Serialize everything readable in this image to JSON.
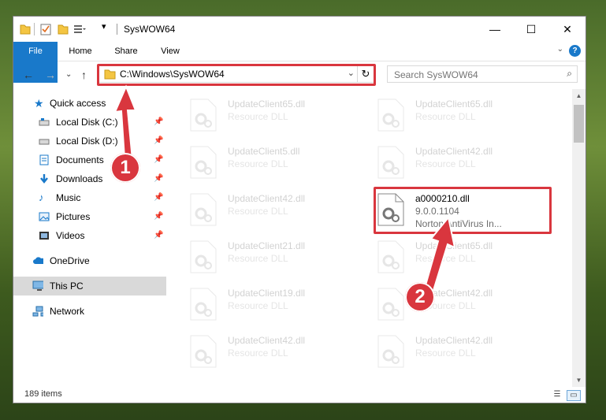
{
  "window": {
    "title": "SysWOW64",
    "minimize": "—",
    "maximize": "☐",
    "close": "✕"
  },
  "ribbon": {
    "tabs": [
      {
        "label": "File"
      },
      {
        "label": "Home"
      },
      {
        "label": "Share"
      },
      {
        "label": "View"
      }
    ],
    "help": "?"
  },
  "address": {
    "path": "C:\\Windows\\SysWOW64",
    "refresh": "↻"
  },
  "search": {
    "placeholder": "Search SysWOW64"
  },
  "nav": {
    "items": [
      {
        "label": "Quick access",
        "pinned": false
      },
      {
        "label": "Local Disk (C:)",
        "pinned": true
      },
      {
        "label": "Local Disk (D:)",
        "pinned": true
      },
      {
        "label": "Documents",
        "pinned": true
      },
      {
        "label": "Downloads",
        "pinned": true
      },
      {
        "label": "Music",
        "pinned": true
      },
      {
        "label": "Pictures",
        "pinned": true
      },
      {
        "label": "Videos",
        "pinned": true
      },
      {
        "label": "OneDrive",
        "pinned": false
      },
      {
        "label": "This PC",
        "pinned": false,
        "selected": true
      },
      {
        "label": "Network",
        "pinned": false
      }
    ]
  },
  "files": [
    {
      "name": "UpdateClient65.dll",
      "desc": "Resource DLL"
    },
    {
      "name": "UpdateClient65.dll",
      "desc": "Resource DLL"
    },
    {
      "name": "UpdateClient5.dll",
      "desc": "Resource DLL"
    },
    {
      "name": "UpdateClient42.dll",
      "desc": "Resource DLL"
    },
    {
      "name": "UpdateClient42.dll",
      "desc": "Resource DLL"
    },
    {
      "name": "a0000210.dll",
      "version": "9.0.0.1104",
      "company": "Norton AntiVirus In...",
      "highlighted": true
    },
    {
      "name": "UpdateClient21.dll",
      "desc": "Resource DLL"
    },
    {
      "name": "UpdateClient65.dll",
      "desc": "Resource DLL"
    },
    {
      "name": "UpdateClient19.dll",
      "desc": "Resource DLL"
    },
    {
      "name": "UpdateClient42.dll",
      "desc": "Resource DLL"
    },
    {
      "name": "UpdateClient42.dll",
      "desc": "Resource DLL"
    },
    {
      "name": "UpdateClient42.dll",
      "desc": "Resource DLL"
    }
  ],
  "status": {
    "item_count": "189 items"
  },
  "callouts": {
    "one": "1",
    "two": "2"
  },
  "colors": {
    "accent": "#1979ca",
    "callout": "#d9363e",
    "selection": "#d9d9d9"
  }
}
